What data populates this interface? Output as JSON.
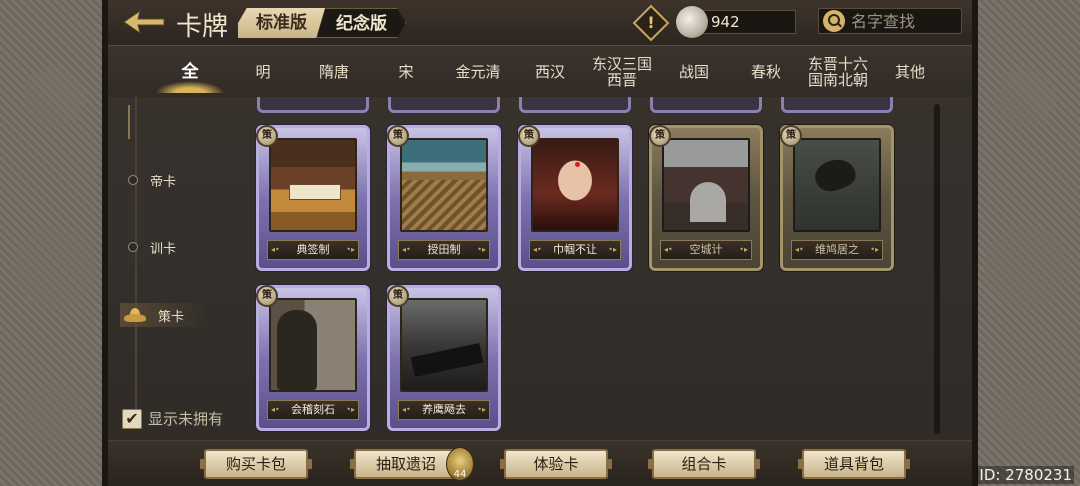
{
  "header": {
    "title": "卡牌",
    "version_tabs": [
      {
        "label": "标准版",
        "active": true
      },
      {
        "label": "纪念版",
        "active": false
      }
    ],
    "coin_value": "942",
    "search_placeholder": "名字查找"
  },
  "dynasty_tabs": [
    {
      "label": "全",
      "active": true
    },
    {
      "label": "明"
    },
    {
      "label": "隋唐"
    },
    {
      "label": "宋"
    },
    {
      "label": "金元清"
    },
    {
      "label": "西汉"
    },
    {
      "label": "东汉三国\n西晋"
    },
    {
      "label": "战国"
    },
    {
      "label": "春秋"
    },
    {
      "label": "东晋十六\n国南北朝"
    },
    {
      "label": "其他"
    }
  ],
  "side_nav": [
    {
      "label": "帝卡"
    },
    {
      "label": "训卡"
    },
    {
      "label": "策卡",
      "active": true
    }
  ],
  "cards": [
    {
      "name": "典签制",
      "badge": "策",
      "frame": "purple"
    },
    {
      "name": "授田制",
      "badge": "策",
      "frame": "purple"
    },
    {
      "name": "巾帼不让",
      "badge": "策",
      "frame": "purple"
    },
    {
      "name": "空城计",
      "badge": "策",
      "frame": "gold"
    },
    {
      "name": "维鸠居之",
      "badge": "策",
      "frame": "gold"
    },
    {
      "name": "会稽刻石",
      "badge": "策",
      "frame": "purple"
    },
    {
      "name": "养鹰飏去",
      "badge": "策",
      "frame": "purple"
    }
  ],
  "show_unowned": {
    "label": "显示未拥有",
    "checked": "✔"
  },
  "buttons": {
    "buy_pack": "购买卡包",
    "draw_edict": "抽取遗诏",
    "draw_count": "44",
    "trial_card": "体验卡",
    "combo_card": "组合卡",
    "item_bag": "道具背包"
  },
  "id_label": "ID: 2780231",
  "icons": {
    "back": "back-arrow-icon",
    "warning": "!",
    "search": "search-icon"
  },
  "colors": {
    "accent_gold": "#d9b35a",
    "purple_frame": "#b8aee0",
    "gold_frame": "#a4946a"
  }
}
